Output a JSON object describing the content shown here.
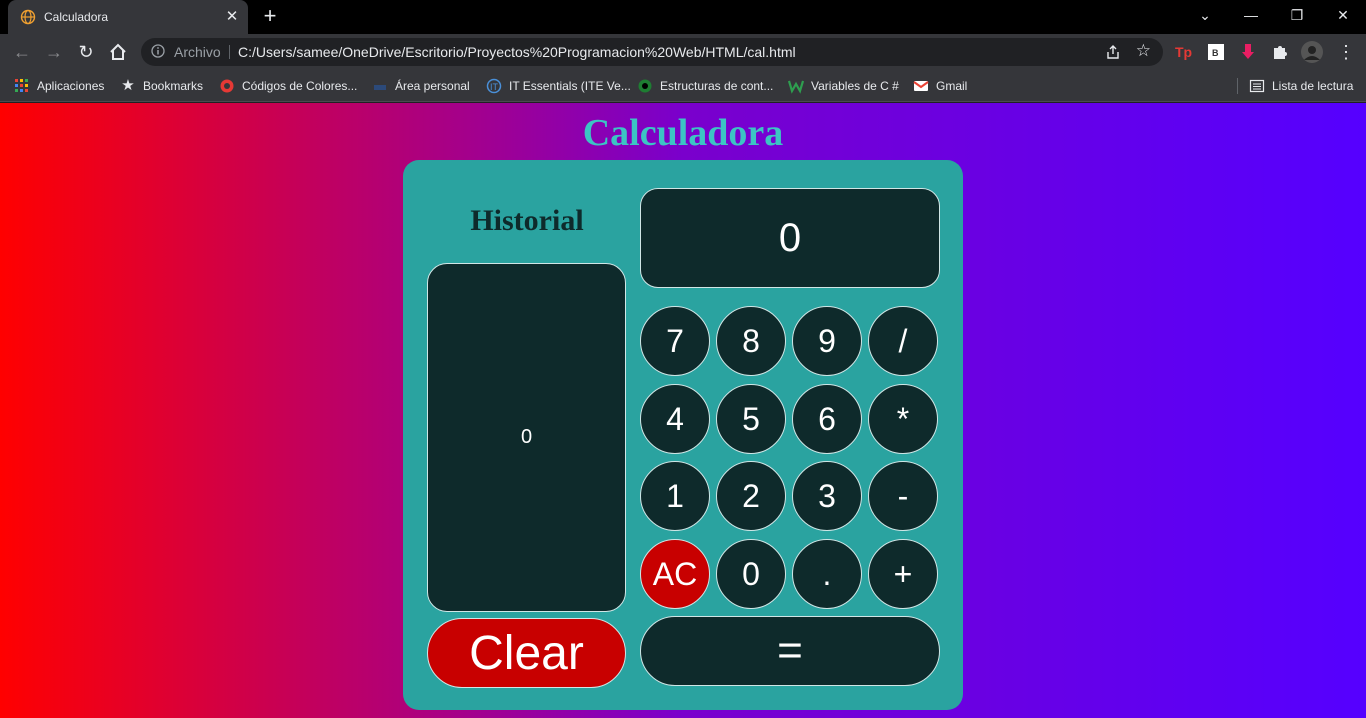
{
  "browser": {
    "tab_title": "Calculadora",
    "tab_close": "✕",
    "new_tab": "+",
    "url_scheme": "Archivo",
    "url": "C:/Users/samee/OneDrive/Escritorio/Proyectos%20Programacion%20Web/HTML/cal.html",
    "bookmarks": [
      {
        "label": "Aplicaciones",
        "icon": "apps-grid-icon"
      },
      {
        "label": "Bookmarks",
        "icon": "star-icon"
      },
      {
        "label": "Códigos de Colores...",
        "icon": "color-codes-icon"
      },
      {
        "label": "Área personal",
        "icon": "personal-area-icon"
      },
      {
        "label": "IT Essentials (ITE Ve...",
        "icon": "it-essentials-icon"
      },
      {
        "label": "Estructuras de cont...",
        "icon": "structures-icon"
      },
      {
        "label": "Variables de C #",
        "icon": "w-icon"
      },
      {
        "label": "Gmail",
        "icon": "gmail-icon"
      }
    ],
    "reading_list": "Lista de lectura"
  },
  "page": {
    "title": "Calculadora",
    "history_label": "Historial",
    "history_value": "0",
    "display_value": "0",
    "keys": [
      "7",
      "8",
      "9",
      "/",
      "4",
      "5",
      "6",
      "*",
      "1",
      "2",
      "3",
      "-",
      "AC",
      "0",
      ".",
      "+"
    ],
    "clear_label": "Clear",
    "equals_label": "="
  },
  "colors": {
    "panel": "#2aa3a0",
    "dark": "#0e2a2b",
    "red": "#c80000",
    "title": "#3cc4c4"
  }
}
